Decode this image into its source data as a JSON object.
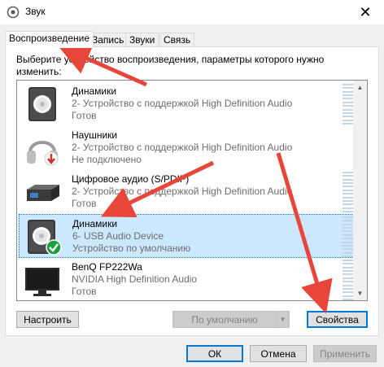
{
  "window": {
    "title": "Звук",
    "close_glyph": "✕"
  },
  "tabs": [
    {
      "label": "Воспроизведение",
      "active": true
    },
    {
      "label": "Запись"
    },
    {
      "label": "Звуки"
    },
    {
      "label": "Связь"
    }
  ],
  "instruction": "Выберите устройство воспроизведения, параметры которого нужно изменить:",
  "devices": [
    {
      "name": "Динамики",
      "description": "2- Устройство с поддержкой High Definition Audio",
      "status": "Готов",
      "icon": "speaker-icon"
    },
    {
      "name": "Наушники",
      "description": "2- Устройство с поддержкой High Definition Audio",
      "status": "Не подключено",
      "icon": "headphones-icon",
      "badge": "disconnected-arrow-icon"
    },
    {
      "name": "Цифровое аудио (S/PDIF)",
      "description": "2- Устройство с поддержкой High Definition Audio",
      "status": "Готов",
      "icon": "digital-audio-icon"
    },
    {
      "name": "Динамики",
      "description": "6- USB Audio Device",
      "status": "Устройство по умолчанию",
      "icon": "speaker-icon",
      "badge": "default-check-icon",
      "selected": true
    },
    {
      "name": "BenQ FP222Wa",
      "description": "NVIDIA High Definition Audio",
      "status": "Готов",
      "icon": "monitor-icon"
    }
  ],
  "buttons": {
    "configure": "Настроить",
    "set_default": "По умолчанию",
    "properties": "Свойства",
    "ok": "ОК",
    "cancel": "Отмена",
    "apply": "Применить"
  },
  "colors": {
    "accent": "#0078d7",
    "selection": "#cce8ff",
    "annotation_arrow": "#e8463b",
    "default_check": "#1d9e3f",
    "disconnected_badge": "#d22f2f"
  }
}
